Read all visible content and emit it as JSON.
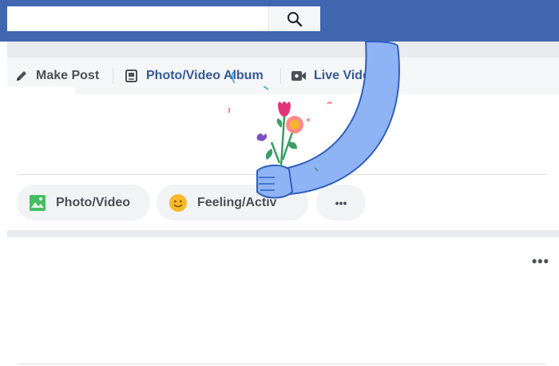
{
  "search": {
    "placeholder": ""
  },
  "composer": {
    "tabs": [
      {
        "label": "Make Post",
        "icon": "pencil-icon"
      },
      {
        "label": "Photo/Video Album",
        "icon": "photo-album-icon"
      },
      {
        "label": "Live Vide",
        "icon": "video-camera-icon"
      }
    ],
    "actions": [
      {
        "label": "Photo/Video",
        "icon": "photo-icon",
        "color": "#45bd62"
      },
      {
        "label": "Feeling/Activ",
        "icon": "smiley-icon",
        "color": "#f7b928"
      },
      {
        "label": "",
        "icon": "more-icon"
      }
    ]
  },
  "post": {
    "more_label": "•••"
  },
  "colors": {
    "brand": "#4267b2",
    "background": "#e9ebee",
    "text": "#4b4f56",
    "sticker_blue": "#8fb4f6"
  },
  "sticker": {
    "name": "hand-with-flowers-sticker"
  }
}
